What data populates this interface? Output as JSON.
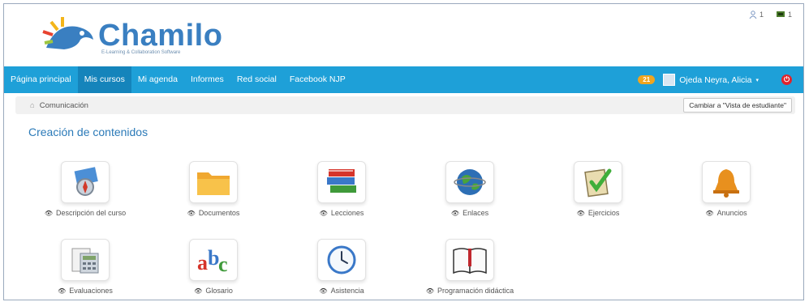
{
  "brand": {
    "name": "Chamilo",
    "tagline": "E-Learning & Collaboration Software"
  },
  "top_right": {
    "users_count": "1",
    "flag_count": "1"
  },
  "nav": {
    "items": [
      "Página principal",
      "Mis cursos",
      "Mi agenda",
      "Informes",
      "Red social",
      "Facebook NJP"
    ],
    "active": "Mis cursos",
    "badge": "21",
    "user_name": "Ojeda Neyra, Alicia"
  },
  "breadcrumb": {
    "current": "Comunicación",
    "switch_label": "Cambiar a \"Vista de estudiante\""
  },
  "section": {
    "title": "Creación de contenidos"
  },
  "tools": [
    {
      "label": "Descripción del curso",
      "icon": "compass-icon"
    },
    {
      "label": "Documentos",
      "icon": "folder-icon"
    },
    {
      "label": "Lecciones",
      "icon": "books-icon"
    },
    {
      "label": "Enlaces",
      "icon": "globe-icon"
    },
    {
      "label": "Ejercicios",
      "icon": "checklist-icon"
    },
    {
      "label": "Anuncios",
      "icon": "bell-icon"
    },
    {
      "label": "Evaluaciones",
      "icon": "calculator-icon"
    },
    {
      "label": "Glosario",
      "icon": "abc-icon"
    },
    {
      "label": "Asistencia",
      "icon": "clock-icon"
    },
    {
      "label": "Programación didáctica",
      "icon": "book-icon"
    }
  ],
  "colors": {
    "navbar": "#1ea0d8",
    "accent": "#2b7ab8",
    "badge": "#f0a51e"
  }
}
